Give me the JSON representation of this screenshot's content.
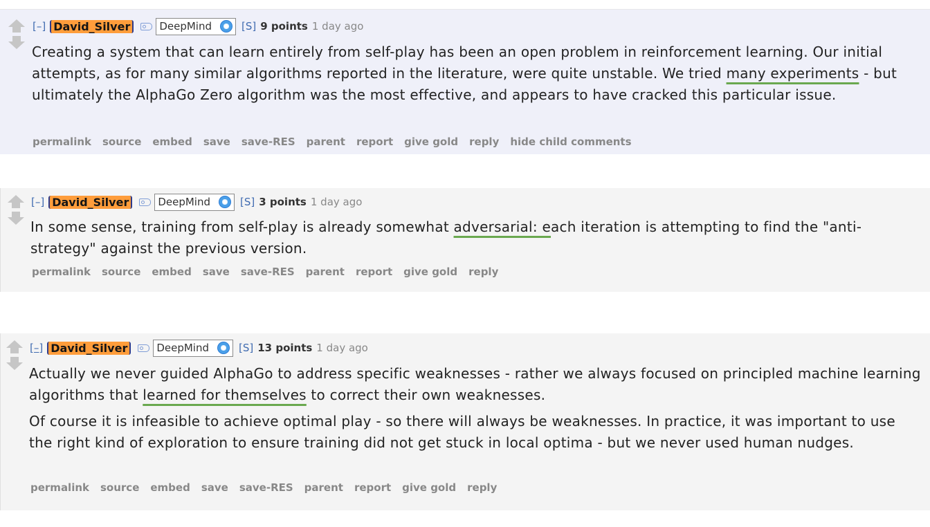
{
  "comments": [
    {
      "collapse_label": "[–]",
      "author": "David_Silver",
      "flair": "DeepMind",
      "submitter_tag": "[S]",
      "points": "9 points",
      "time": "1 day ago",
      "paragraphs": [
        {
          "before": "Creating a system that can learn entirely from self-play has been an open problem in reinforcement learning. Our initial attempts, as for many similar algorithms reported in the literature, were quite unstable. We tried ",
          "highlight": "many experiments",
          "after": " - but ultimately the AlphaGo Zero algorithm was the most effective, and appears to have cracked this particular issue."
        }
      ],
      "buttons": [
        "permalink",
        "source",
        "embed",
        "save",
        "save-RES",
        "parent",
        "report",
        "give gold",
        "reply",
        "hide child comments"
      ]
    },
    {
      "collapse_label": "[–]",
      "author": "David_Silver",
      "flair": "DeepMind",
      "submitter_tag": "[S]",
      "points": "3 points",
      "time": "1 day ago",
      "paragraphs": [
        {
          "before": "In some sense, training from self-play is already somewhat ",
          "highlight": "adversarial: e",
          "after": "ach iteration is attempting to find the \"anti-strategy\" against the previous version."
        }
      ],
      "buttons": [
        "permalink",
        "source",
        "embed",
        "save",
        "save-RES",
        "parent",
        "report",
        "give gold",
        "reply"
      ]
    },
    {
      "collapse_label": "[–]",
      "author": "David_Silver",
      "flair": "DeepMind",
      "submitter_tag": "[S]",
      "points": "13 points",
      "time": "1 day ago",
      "paragraphs": [
        {
          "before": "Actually we never guided AlphaGo to address specific weaknesses - rather we always focused on principled machine learning algorithms that ",
          "highlight": "learned for themselves",
          "after": " to correct their own weaknesses."
        },
        {
          "text": "Of course it is infeasible to achieve optimal play - so there will always be weaknesses. In practice, it was important to use the right kind of exploration to ensure training did not get stuck in local optima - but we never used human nudges."
        }
      ],
      "buttons": [
        "permalink",
        "source",
        "embed",
        "save",
        "save-RES",
        "parent",
        "report",
        "give gold",
        "reply"
      ]
    }
  ],
  "colors": {
    "highlight_underline": "#6aa84f",
    "author_bg": "#ff9d3b",
    "link_blue": "#3f6bb0",
    "first_comment_bg": "#eff0f9",
    "comment_bg": "#f4f4f4"
  }
}
